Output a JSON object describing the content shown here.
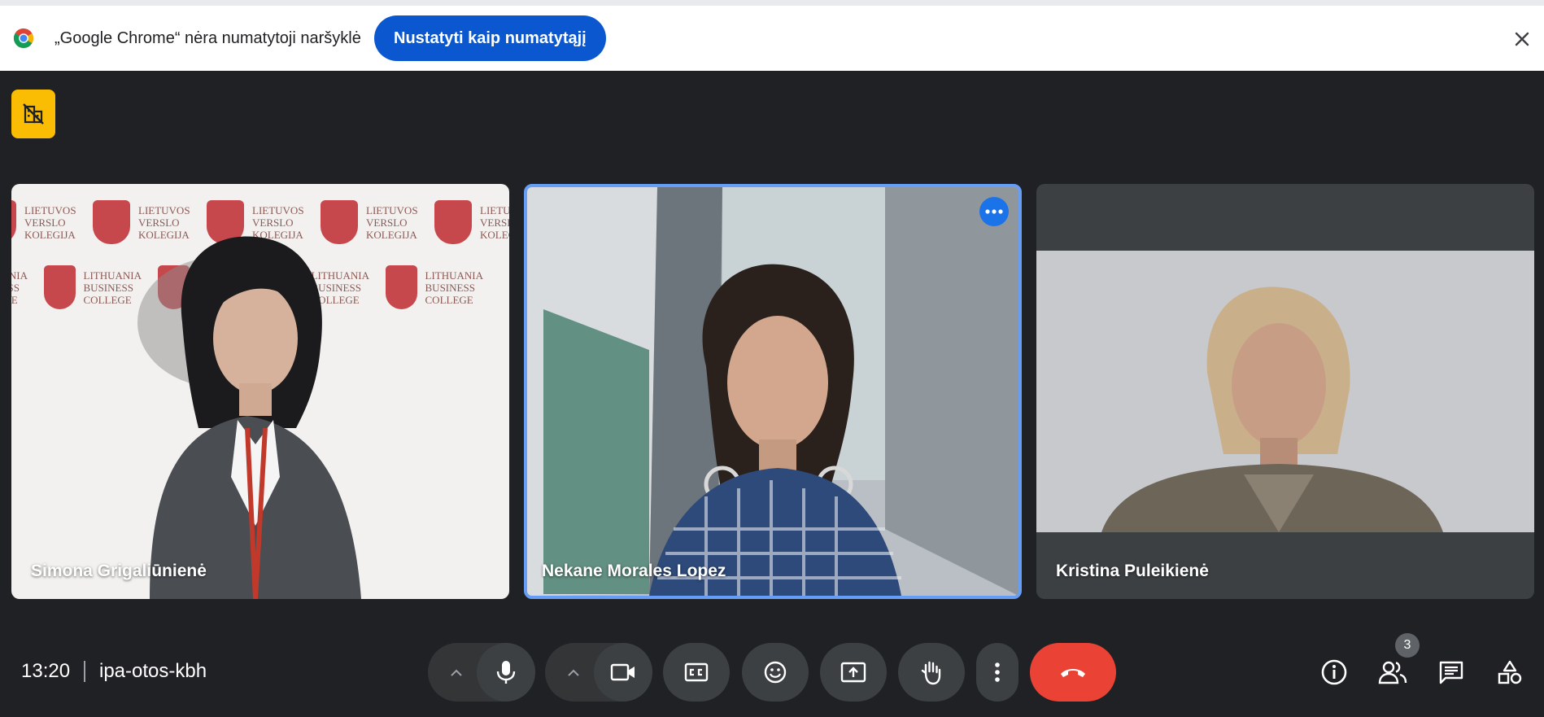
{
  "infobar": {
    "message": "„Google Chrome“ nėra numatytoji naršyklė",
    "set_default_label": "Nustatyti kaip numatytąjį"
  },
  "tiles": [
    {
      "name": "Simona Grigaliūnienė",
      "backdrop_text_1": [
        "LIETUVOS",
        "VERSLO",
        "KOLEGIJA"
      ],
      "backdrop_text_2": [
        "LITHUANIA",
        "BUSINESS",
        "COLLEGE"
      ]
    },
    {
      "name": "Nekane Morales Lopez",
      "active_speaker": true
    },
    {
      "name": "Kristina Puleikienė"
    }
  ],
  "bottom_bar": {
    "time": "13:20",
    "meeting_code": "ipa-otos-kbh",
    "people_count": "3"
  },
  "icons": {
    "badge": "no-building-icon",
    "mic": "mic-icon",
    "camera": "camera-icon",
    "captions": "cc-icon",
    "reactions": "emoji-icon",
    "present": "present-screen-icon",
    "raise_hand": "hand-icon",
    "more": "more-vert-icon",
    "end_call": "phone-hangup-icon",
    "info": "info-icon",
    "people": "people-icon",
    "chat": "chat-icon",
    "activities": "shapes-icon"
  },
  "colors": {
    "background": "#202124",
    "primary_button": "#0b57d0",
    "end_call": "#ea4335",
    "active_border": "#669df6",
    "badge": "#fbbc04"
  }
}
